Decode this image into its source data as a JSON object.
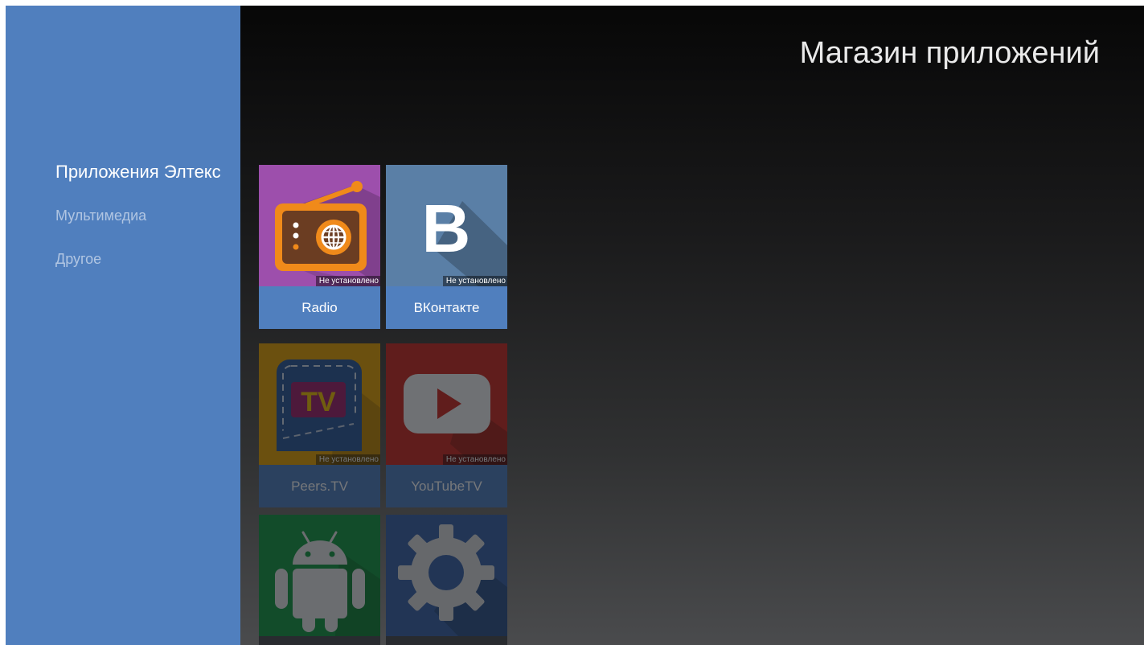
{
  "header": {
    "title": "Магазин приложений"
  },
  "sidebar": {
    "items": [
      {
        "label": "Приложения Элтекс",
        "active": true
      },
      {
        "label": "Мультимедиа",
        "active": false
      },
      {
        "label": "Другое",
        "active": false
      }
    ]
  },
  "apps": [
    {
      "name": "Radio",
      "status": "Не установлено",
      "icon": "radio-icon",
      "tile_color": "#9d4fac",
      "focused": true
    },
    {
      "name": "ВКонтакте",
      "status": "Не установлено",
      "icon": "vk-icon",
      "tile_color": "#5a7fa6",
      "focused": true
    },
    {
      "name": "Peers.TV",
      "status": "Не установлено",
      "icon": "peers-tv-icon",
      "tile_color": "#e6a200",
      "focused": false
    },
    {
      "name": "YouTubeTV",
      "status": "Не установлено",
      "icon": "youtube-icon",
      "tile_color": "#cc2a1f",
      "focused": false
    },
    {
      "name": "",
      "status": "",
      "icon": "android-icon",
      "tile_color": "#149a40",
      "focused": false
    },
    {
      "name": "",
      "status": "",
      "icon": "settings-gear-icon",
      "tile_color": "#3a63a8",
      "focused": false
    }
  ],
  "colors": {
    "sidebar": "#507fbe",
    "accent": "#507fbe"
  }
}
